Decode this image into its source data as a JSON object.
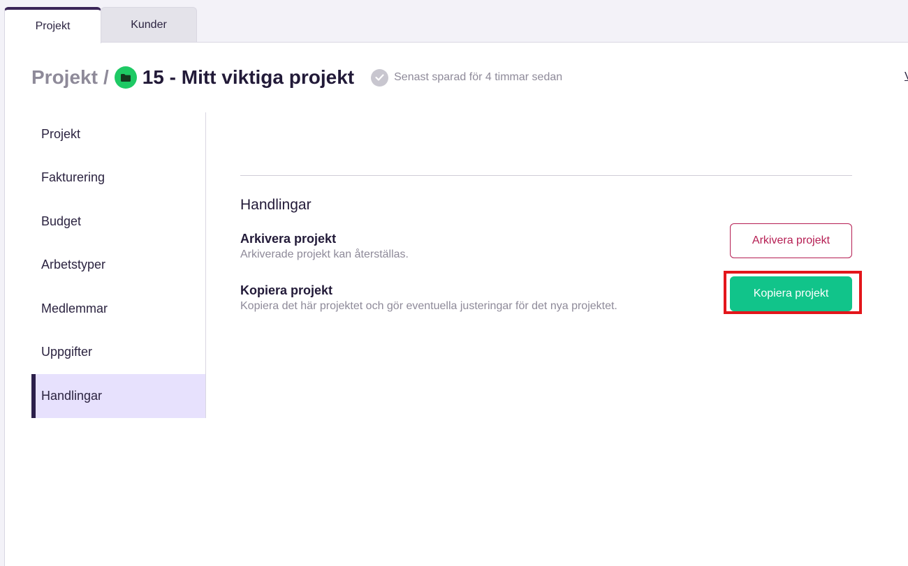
{
  "tabs": [
    {
      "label": "Projekt",
      "active": true
    },
    {
      "label": "Kunder",
      "active": false
    }
  ],
  "header": {
    "breadcrumb_root": "Projekt",
    "separator": "/",
    "project_title": "15 - Mitt viktiga projekt",
    "saved_status": "Senast sparad för 4 timmar sedan",
    "edge_link": "V"
  },
  "sidenav": {
    "items": [
      {
        "label": "Projekt"
      },
      {
        "label": "Fakturering"
      },
      {
        "label": "Budget"
      },
      {
        "label": "Arbetstyper"
      },
      {
        "label": "Medlemmar"
      },
      {
        "label": "Uppgifter"
      },
      {
        "label": "Handlingar",
        "active": true
      }
    ]
  },
  "content": {
    "section_title": "Handlingar",
    "actions": [
      {
        "title": "Arkivera projekt",
        "description": "Arkiverade projekt kan återställas.",
        "button_label": "Arkivera projekt"
      },
      {
        "title": "Kopiera projekt",
        "description": "Kopiera det här projektet och gör eventuella justeringar för det nya projektet.",
        "button_label": "Kopiera projekt"
      }
    ]
  },
  "colors": {
    "accent_dark": "#2b1f4a",
    "active_nav_bg": "#e7e1fd",
    "status_green": "#1ec964",
    "archive_red": "#b51d52",
    "copy_green": "#11c48a",
    "highlight_red": "#e3161b"
  },
  "icons": {
    "project_status": "folder-icon",
    "saved_status": "check-circle-icon"
  }
}
